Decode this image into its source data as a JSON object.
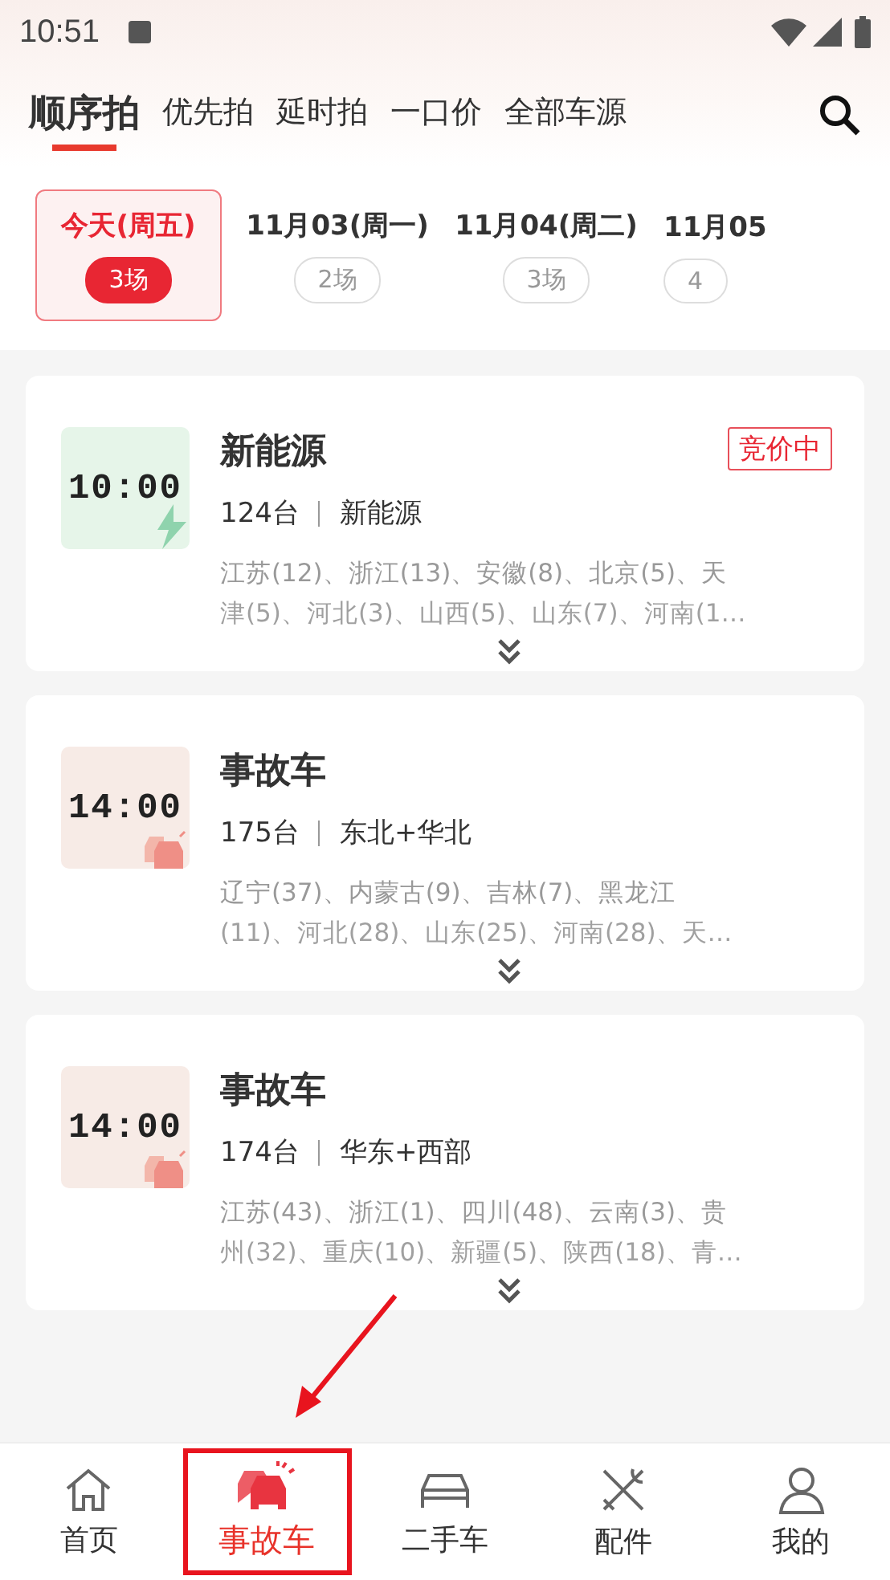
{
  "status_bar": {
    "time": "10:51"
  },
  "top_tabs": [
    {
      "label": "顺序拍",
      "selected": true
    },
    {
      "label": "优先拍",
      "selected": false
    },
    {
      "label": "延时拍",
      "selected": false
    },
    {
      "label": "一口价",
      "selected": false
    },
    {
      "label": "全部车源",
      "selected": false
    }
  ],
  "date_tabs": [
    {
      "label": "今天(周五)",
      "count": "3场",
      "selected": true
    },
    {
      "label": "11月03(周一)",
      "count": "2场",
      "selected": false
    },
    {
      "label": "11月04(周二)",
      "count": "3场",
      "selected": false
    },
    {
      "label": "11月05",
      "count": "4",
      "selected": false
    }
  ],
  "sessions": [
    {
      "time": "10:00",
      "kind": "electric",
      "title": "新能源",
      "status": "竞价中",
      "count": "124台",
      "area": "新能源",
      "regions_line_1": "江苏(12)、浙江(13)、安徽(8)、北京(5)、天",
      "regions_line_2": "津(5)、河北(3)、山西(5)、山东(7)、河南(1…"
    },
    {
      "time": "14:00",
      "kind": "accident",
      "title": "事故车",
      "count": "175台",
      "area": "东北+华北",
      "regions_line_1": "辽宁(37)、内蒙古(9)、吉林(7)、黑龙江",
      "regions_line_2": "(11)、河北(28)、山东(25)、河南(28)、天…"
    },
    {
      "time": "14:00",
      "kind": "accident",
      "title": "事故车",
      "count": "174台",
      "area": "华东+西部",
      "regions_line_1": "江苏(43)、浙江(1)、四川(48)、云南(3)、贵",
      "regions_line_2": "州(32)、重庆(10)、新疆(5)、陕西(18)、青…"
    }
  ],
  "bottom_nav": [
    {
      "label": "首页",
      "kind": "home",
      "selected": false,
      "highlighted": false
    },
    {
      "label": "事故车",
      "kind": "accident",
      "selected": true,
      "highlighted": true
    },
    {
      "label": "二手车",
      "kind": "car",
      "selected": false,
      "highlighted": false
    },
    {
      "label": "配件",
      "kind": "parts",
      "selected": false,
      "highlighted": false
    },
    {
      "label": "我的",
      "kind": "user",
      "selected": false,
      "highlighted": false
    }
  ]
}
